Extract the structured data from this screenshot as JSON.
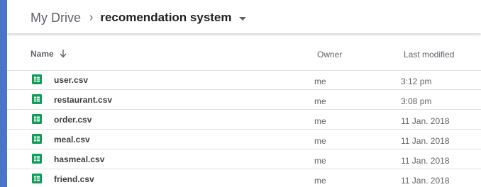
{
  "breadcrumb": {
    "root": "My Drive",
    "separator": "›",
    "current": "recomendation system"
  },
  "columns": {
    "name": "Name",
    "owner": "Owner",
    "last_modified": "Last modified"
  },
  "files": [
    {
      "name": "user.csv",
      "owner": "me",
      "modified": "3:12 pm",
      "icon": "spreadsheet-icon"
    },
    {
      "name": "restaurant.csv",
      "owner": "me",
      "modified": "3:08 pm",
      "icon": "spreadsheet-icon"
    },
    {
      "name": "order.csv",
      "owner": "me",
      "modified": "11 Jan. 2018",
      "icon": "spreadsheet-icon"
    },
    {
      "name": "meal.csv",
      "owner": "me",
      "modified": "11 Jan. 2018",
      "icon": "spreadsheet-icon"
    },
    {
      "name": "hasmeal.csv",
      "owner": "me",
      "modified": "11 Jan. 2018",
      "icon": "spreadsheet-icon"
    },
    {
      "name": "friend.csv",
      "owner": "me",
      "modified": "11 Jan. 2018",
      "icon": "spreadsheet-icon"
    }
  ],
  "colors": {
    "frame_border": "#4a74c4",
    "sheets_green": "#0f9d58"
  }
}
